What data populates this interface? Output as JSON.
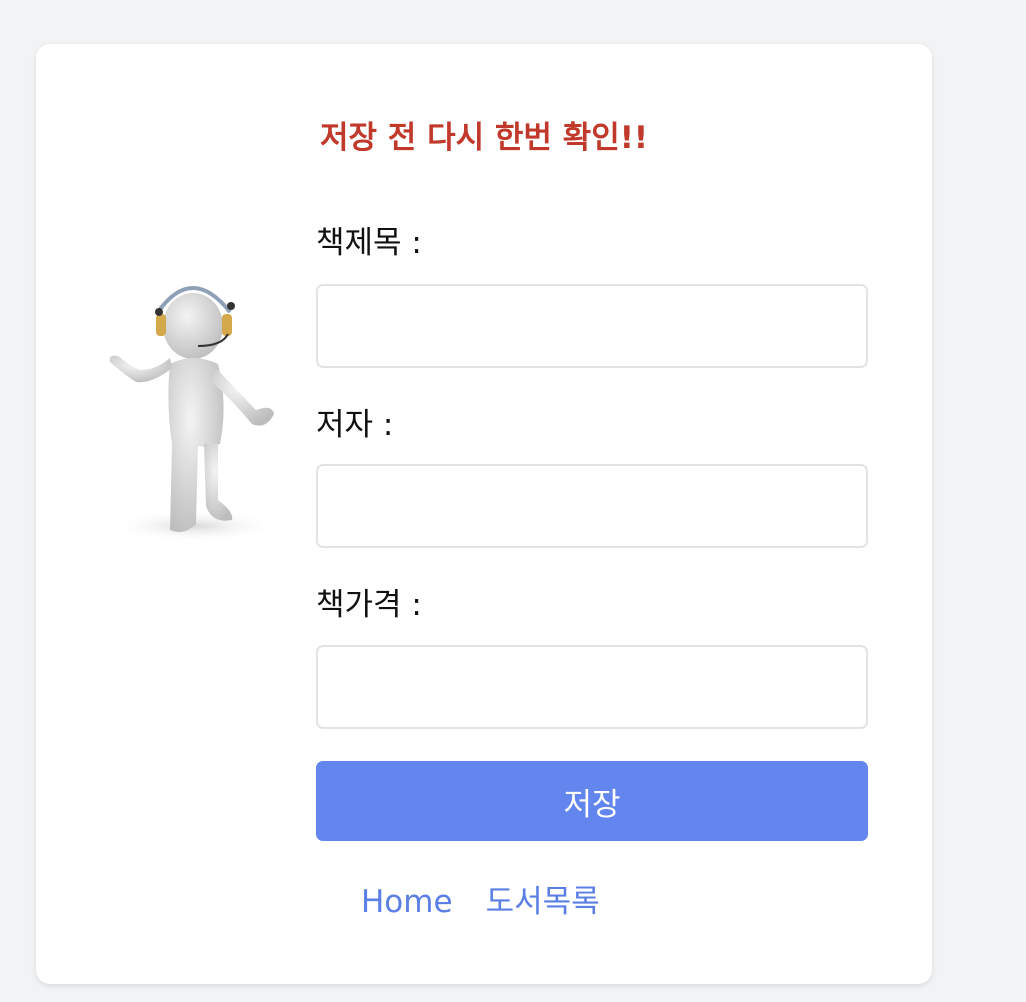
{
  "colors": {
    "title": "#c0392b",
    "accent": "#6286ee",
    "link": "#5b7fe5",
    "background": "#f2f3f5",
    "card": "#ffffff"
  },
  "form": {
    "heading": "저장 전 다시 한번 확인!!",
    "fields": [
      {
        "label": "책제목 :",
        "value": "",
        "placeholder": ""
      },
      {
        "label": "저자 :",
        "value": "",
        "placeholder": ""
      },
      {
        "label": "책가격 :",
        "value": "",
        "placeholder": ""
      }
    ],
    "save_label": "저장"
  },
  "illustration": {
    "icon": "headset-person-icon"
  },
  "nav": {
    "home_label": "Home",
    "list_label": "도서목록"
  }
}
